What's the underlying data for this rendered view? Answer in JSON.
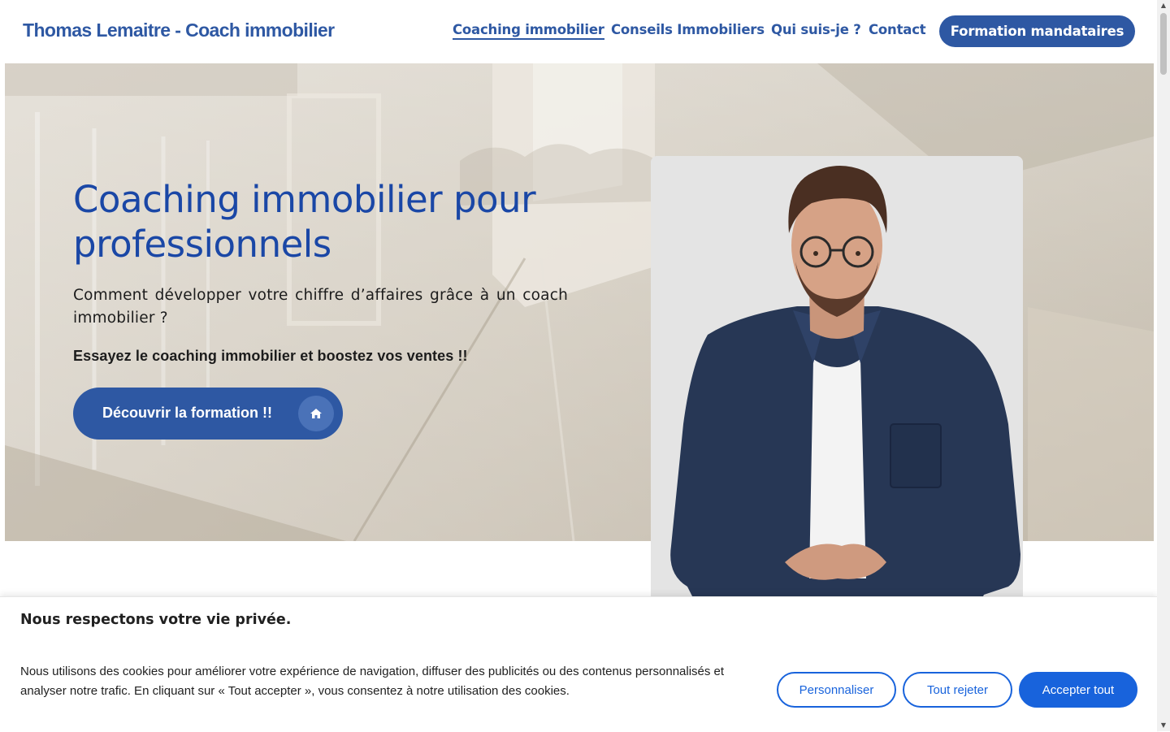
{
  "header": {
    "site_title": "Thomas Lemaitre - Coach immobilier",
    "nav": [
      {
        "label": "Coaching immobilier",
        "active": true
      },
      {
        "label": "Conseils Immobiliers",
        "active": false
      },
      {
        "label": "Qui suis-je ?",
        "active": false
      },
      {
        "label": "Contact",
        "active": false
      }
    ],
    "cta_label": "Formation mandataires"
  },
  "hero": {
    "title": "Coaching immobilier pour professionnels",
    "subtitle": "Comment développer votre chiffre d’affaires grâce à un coach immobilier ?",
    "tagline": "Essayez le coaching immobilier et boostez vos ventes !!",
    "button_label": "Découvrir la formation !!",
    "button_icon": "home-icon"
  },
  "cookie_banner": {
    "title": "Nous respectons votre vie privée.",
    "text": "Nous utilisons des cookies pour améliorer votre expérience de navigation, diffuser des publicités ou des contenus personnalisés et analyser notre trafic. En cliquant sur « Tout accepter », vous consentez à notre utilisation des cookies.",
    "buttons": {
      "customize": "Personnaliser",
      "reject": "Tout rejeter",
      "accept": "Accepter tout"
    }
  },
  "colors": {
    "brand_blue": "#2e58a3",
    "title_blue": "#1a47a6",
    "cookie_blue": "#1863dc"
  }
}
